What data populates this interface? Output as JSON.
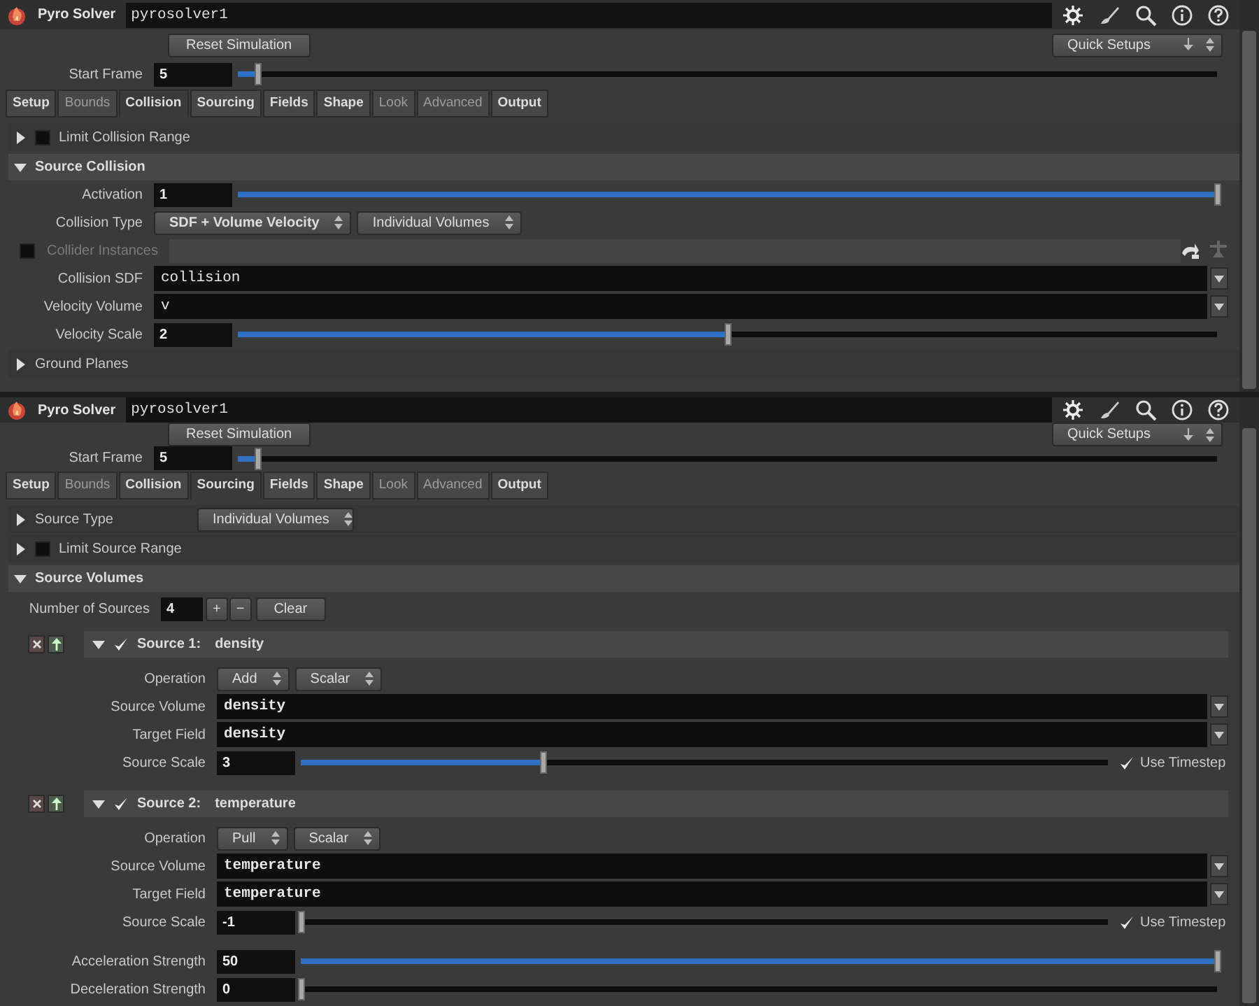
{
  "panels": [
    {
      "header": {
        "node_type": "Pyro Solver",
        "node_name": "pyrosolver1"
      },
      "reset_button": "Reset Simulation",
      "quick_setups": "Quick Setups",
      "start_frame": {
        "label": "Start Frame",
        "value": "5",
        "level": 0.02
      },
      "tabs": [
        {
          "label": "Setup",
          "selected": false,
          "emphasized": true
        },
        {
          "label": "Bounds",
          "selected": false,
          "emphasized": false
        },
        {
          "label": "Collision",
          "selected": true,
          "emphasized": true
        },
        {
          "label": "Sourcing",
          "selected": false,
          "emphasized": true
        },
        {
          "label": "Fields",
          "selected": false,
          "emphasized": true
        },
        {
          "label": "Shape",
          "selected": false,
          "emphasized": true
        },
        {
          "label": "Look",
          "selected": false,
          "emphasized": false
        },
        {
          "label": "Advanced",
          "selected": false,
          "emphasized": false
        },
        {
          "label": "Output",
          "selected": false,
          "emphasized": true
        }
      ],
      "rows": [
        {
          "kind": "folder",
          "label": "Limit Collision Range",
          "expanded": false,
          "checked": false
        },
        {
          "kind": "section",
          "label": "Source Collision",
          "expanded": true
        },
        {
          "kind": "slider",
          "label": "Activation",
          "value": "1",
          "level": 1
        },
        {
          "kind": "menus",
          "label": "Collision Type",
          "menus": [
            "SDF + Volume Velocity",
            "Individual Volumes"
          ]
        },
        {
          "kind": "toggle_field",
          "label": "Collider Instances",
          "checked": false,
          "disabled": true
        },
        {
          "kind": "string",
          "label": "Collision SDF",
          "value": "collision"
        },
        {
          "kind": "string",
          "label": "Velocity Volume",
          "value": "v"
        },
        {
          "kind": "slider",
          "label": "Velocity Scale",
          "value": "2",
          "level": 0.5
        },
        {
          "kind": "folder",
          "label": "Ground Planes",
          "expanded": false
        }
      ]
    },
    {
      "header": {
        "node_type": "Pyro Solver",
        "node_name": "pyrosolver1"
      },
      "reset_button": "Reset Simulation",
      "quick_setups": "Quick Setups",
      "start_frame": {
        "label": "Start Frame",
        "value": "5",
        "level": 0.02
      },
      "tabs": [
        {
          "label": "Setup",
          "selected": false,
          "emphasized": true
        },
        {
          "label": "Bounds",
          "selected": false,
          "emphasized": false
        },
        {
          "label": "Collision",
          "selected": false,
          "emphasized": true
        },
        {
          "label": "Sourcing",
          "selected": true,
          "emphasized": true
        },
        {
          "label": "Fields",
          "selected": false,
          "emphasized": true
        },
        {
          "label": "Shape",
          "selected": false,
          "emphasized": true
        },
        {
          "label": "Look",
          "selected": false,
          "emphasized": false
        },
        {
          "label": "Advanced",
          "selected": false,
          "emphasized": false
        },
        {
          "label": "Output",
          "selected": false,
          "emphasized": true
        }
      ],
      "rows": [
        {
          "kind": "folder",
          "label": "Source Type",
          "expanded": false,
          "menu": "Individual Volumes"
        },
        {
          "kind": "folder",
          "label": "Limit Source Range",
          "expanded": false,
          "checked": false
        },
        {
          "kind": "section",
          "label": "Source Volumes",
          "expanded": true
        },
        {
          "kind": "count",
          "label": "Number of Sources",
          "value": "4",
          "plus": "+",
          "minus": "−",
          "clear": "Clear"
        },
        {
          "kind": "source",
          "title": "Source 1:",
          "name": "density",
          "enabled": true,
          "expanded": true,
          "rows": [
            {
              "kind": "menus",
              "label": "Operation",
              "menus": [
                "Add",
                "Scalar"
              ]
            },
            {
              "kind": "string",
              "label": "Source Volume",
              "value": "density"
            },
            {
              "kind": "string",
              "label": "Target Field",
              "value": "density"
            },
            {
              "kind": "slider",
              "label": "Source Scale",
              "value": "3",
              "level": 0.3,
              "toggle": {
                "label": "Use Timestep",
                "checked": true
              }
            }
          ]
        },
        {
          "kind": "source",
          "title": "Source 2:",
          "name": "temperature",
          "enabled": true,
          "expanded": true,
          "rows": [
            {
              "kind": "menus",
              "label": "Operation",
              "menus": [
                "Pull",
                "Scalar"
              ]
            },
            {
              "kind": "string",
              "label": "Source Volume",
              "value": "temperature"
            },
            {
              "kind": "string",
              "label": "Target Field",
              "value": "temperature"
            },
            {
              "kind": "slider",
              "label": "Source Scale",
              "value": "-1",
              "level": 0,
              "toggle": {
                "label": "Use Timestep",
                "checked": true
              }
            },
            {
              "kind": "spacer"
            },
            {
              "kind": "slider",
              "label": "Acceleration Strength",
              "value": "50",
              "level": 1
            },
            {
              "kind": "slider",
              "label": "Deceleration Strength",
              "value": "0",
              "level": 0
            }
          ]
        }
      ]
    }
  ]
}
